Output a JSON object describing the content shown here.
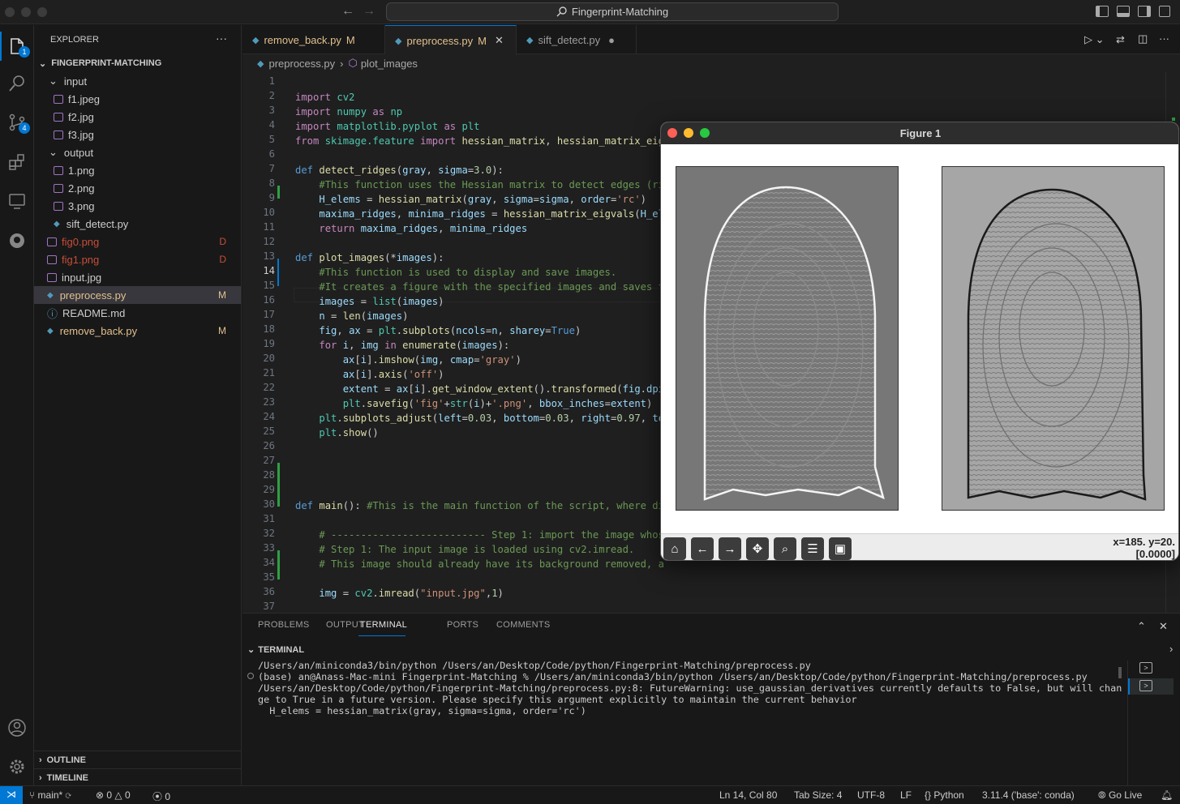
{
  "titlebar": {
    "search_text": "Fingerprint-Matching"
  },
  "activity_badges": {
    "explorer": "1",
    "scm": "4"
  },
  "sidebar": {
    "title": "EXPLORER",
    "more": "···",
    "root": "FINGERPRINT-MATCHING",
    "items": [
      {
        "label": "input",
        "type": "folder",
        "status": ""
      },
      {
        "label": "f1.jpeg",
        "type": "image",
        "status": ""
      },
      {
        "label": "f2.jpg",
        "type": "image",
        "status": ""
      },
      {
        "label": "f3.jpg",
        "type": "image",
        "status": ""
      },
      {
        "label": "output",
        "type": "folder",
        "status": ""
      },
      {
        "label": "1.png",
        "type": "image",
        "status": ""
      },
      {
        "label": "2.png",
        "type": "image",
        "status": ""
      },
      {
        "label": "3.png",
        "type": "image",
        "status": ""
      },
      {
        "label": "sift_detect.py",
        "type": "python",
        "status": ""
      },
      {
        "label": "fig0.png",
        "type": "image",
        "status": "D"
      },
      {
        "label": "fig1.png",
        "type": "image",
        "status": "D"
      },
      {
        "label": "input.jpg",
        "type": "image",
        "status": ""
      },
      {
        "label": "preprocess.py",
        "type": "python",
        "status": "M"
      },
      {
        "label": "README.md",
        "type": "info",
        "status": ""
      },
      {
        "label": "remove_back.py",
        "type": "python",
        "status": "M"
      }
    ],
    "outline": "OUTLINE",
    "timeline": "TIMELINE"
  },
  "tabs": [
    {
      "label": "remove_back.py",
      "badge": "M"
    },
    {
      "label": "preprocess.py",
      "badge": "M"
    },
    {
      "label": "sift_detect.py",
      "badge": "●"
    }
  ],
  "breadcrumb": {
    "file": "preprocess.py",
    "sep": "›",
    "symbol": "plot_images"
  },
  "code": {
    "line_numbers": [
      "1",
      "2",
      "3",
      "4",
      "5",
      "6",
      "7",
      "8",
      "9",
      "10",
      "11",
      "12",
      "13",
      "14",
      "15",
      "16",
      "17",
      "18",
      "19",
      "20",
      "21",
      "22",
      "23",
      "24",
      "25",
      "26",
      "27",
      "28",
      "29",
      "30",
      "31",
      "32",
      "33",
      "34",
      "35",
      "36",
      "37"
    ]
  },
  "figure": {
    "title": "Figure 1",
    "coords_line1": "x=185. y=20.",
    "coords_line2": "[0.0000]"
  },
  "panel": {
    "tabs": [
      "PROBLEMS",
      "OUTPUT",
      "TERMINAL",
      "PORTS",
      "COMMENTS"
    ],
    "active_tab": "TERMINAL",
    "section": "TERMINAL",
    "terminal_lines": [
      "/Users/an/miniconda3/bin/python /Users/an/Desktop/Code/python/Fingerprint-Matching/preprocess.py",
      "(base) an@Anass-Mac-mini Fingerprint-Matching % /Users/an/miniconda3/bin/python /Users/an/Desktop/Code/python/Fingerprint-Matching/preprocess.py",
      "/Users/an/Desktop/Code/python/Fingerprint-Matching/preprocess.py:8: FutureWarning: use_gaussian_derivatives currently defaults to False, but will chan",
      "ge to True in a future version. Please specify this argument explicitly to maintain the current behavior",
      "  H_elems = hessian_matrix(gray, sigma=sigma, order='rc')"
    ]
  },
  "statusbar": {
    "branch": "main*",
    "errors": "0",
    "warnings": "0",
    "ports": "0",
    "position": "Ln 14, Col 80",
    "tab_size": "Tab Size: 4",
    "encoding": "UTF-8",
    "eol": "LF",
    "language": "Python",
    "interpreter": "3.11.4 ('base': conda)",
    "golive": "Go Live"
  }
}
